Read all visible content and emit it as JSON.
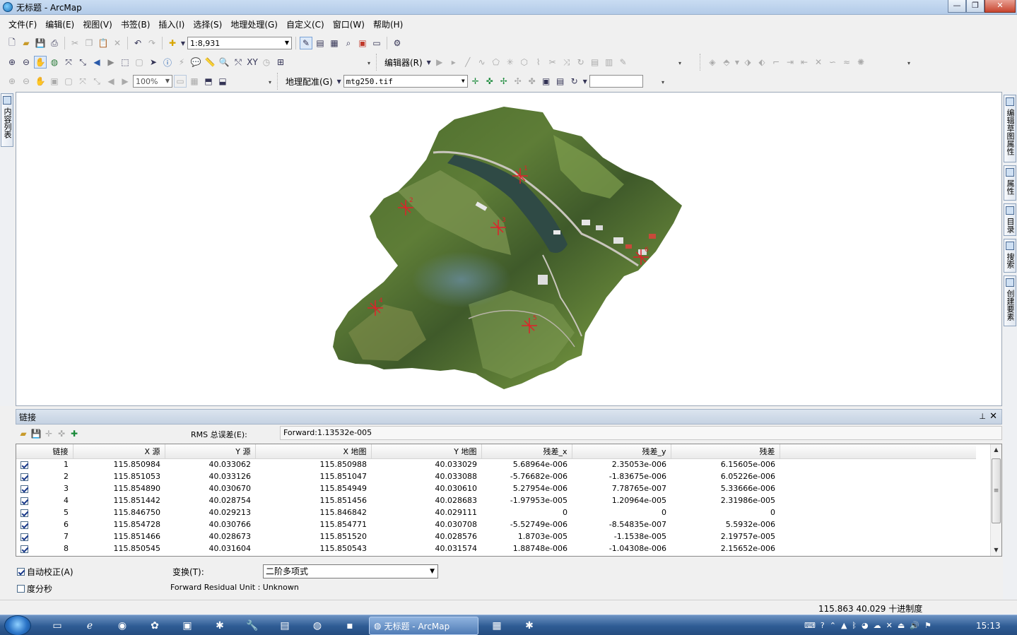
{
  "window": {
    "title": "无标题 - ArcMap"
  },
  "menu": [
    "文件(F)",
    "编辑(E)",
    "视图(V)",
    "书签(B)",
    "插入(I)",
    "选择(S)",
    "地理处理(G)",
    "自定义(C)",
    "窗口(W)",
    "帮助(H)"
  ],
  "toolbar": {
    "scale_value": "1:8,931",
    "editor_label": "编辑器(R)",
    "zoom_percent": "100%",
    "georef_label": "地理配准(G)",
    "layer_value": "mtg250.tif"
  },
  "left_dock": {
    "tab": "内容列表"
  },
  "right_dock": {
    "tabs": [
      "编辑草图属性",
      "属性",
      "目录",
      "搜索",
      "创建要素"
    ]
  },
  "map": {
    "accent_points_color": "#e0202a",
    "link_points": [
      {
        "label": "1"
      },
      {
        "label": "2"
      },
      {
        "label": "3"
      },
      {
        "label": "4"
      },
      {
        "label": "5"
      },
      {
        "label": "6"
      }
    ]
  },
  "links_panel": {
    "title": "链接",
    "rms_label": "RMS 总误差(E):",
    "rms_value": "Forward:1.13532e-005",
    "columns": [
      "链接",
      "X 源",
      "Y 源",
      "X 地图",
      "Y 地图",
      "残差_x",
      "残差_y",
      "残差"
    ],
    "rows": [
      {
        "checked": true,
        "id": "1",
        "x_src": "115.850984",
        "y_src": "40.033062",
        "x_map": "115.850988",
        "y_map": "40.033029",
        "res_x": "5.68964e-006",
        "res_y": "2.35053e-006",
        "res": "6.15605e-006"
      },
      {
        "checked": true,
        "id": "2",
        "x_src": "115.851053",
        "y_src": "40.033126",
        "x_map": "115.851047",
        "y_map": "40.033088",
        "res_x": "-5.76682e-006",
        "res_y": "-1.83675e-006",
        "res": "6.05226e-006"
      },
      {
        "checked": true,
        "id": "3",
        "x_src": "115.854890",
        "y_src": "40.030670",
        "x_map": "115.854949",
        "y_map": "40.030610",
        "res_x": "5.27954e-006",
        "res_y": "7.78765e-007",
        "res": "5.33666e-006"
      },
      {
        "checked": true,
        "id": "4",
        "x_src": "115.851442",
        "y_src": "40.028754",
        "x_map": "115.851456",
        "y_map": "40.028683",
        "res_x": "-1.97953e-005",
        "res_y": "1.20964e-005",
        "res": "2.31986e-005"
      },
      {
        "checked": true,
        "id": "5",
        "x_src": "115.846750",
        "y_src": "40.029213",
        "x_map": "115.846842",
        "y_map": "40.029111",
        "res_x": "0",
        "res_y": "0",
        "res": "0"
      },
      {
        "checked": true,
        "id": "6",
        "x_src": "115.854728",
        "y_src": "40.030766",
        "x_map": "115.854771",
        "y_map": "40.030708",
        "res_x": "-5.52749e-006",
        "res_y": "-8.54835e-007",
        "res": "5.5932e-006"
      },
      {
        "checked": true,
        "id": "7",
        "x_src": "115.851466",
        "y_src": "40.028673",
        "x_map": "115.851520",
        "y_map": "40.028576",
        "res_x": "1.8703e-005",
        "res_y": "-1.1538e-005",
        "res": "2.19757e-005"
      },
      {
        "checked": true,
        "id": "8",
        "x_src": "115.850545",
        "y_src": "40.031604",
        "x_map": "115.850543",
        "y_map": "40.031574",
        "res_x": "1.88748e-006",
        "res_y": "-1.04308e-006",
        "res": "2.15652e-006"
      }
    ],
    "auto_adjust_label": "自动校正(A)",
    "auto_adjust_checked": true,
    "dms_label": "度分秒",
    "dms_checked": false,
    "transform_label": "变换(T):",
    "transform_value": "二阶多项式",
    "residual_unit": "Forward Residual Unit : Unknown"
  },
  "status": {
    "coords": "115.863  40.029 十进制度"
  },
  "taskbar": {
    "active_task": "无标题 - ArcMap",
    "clock": "15:13"
  }
}
